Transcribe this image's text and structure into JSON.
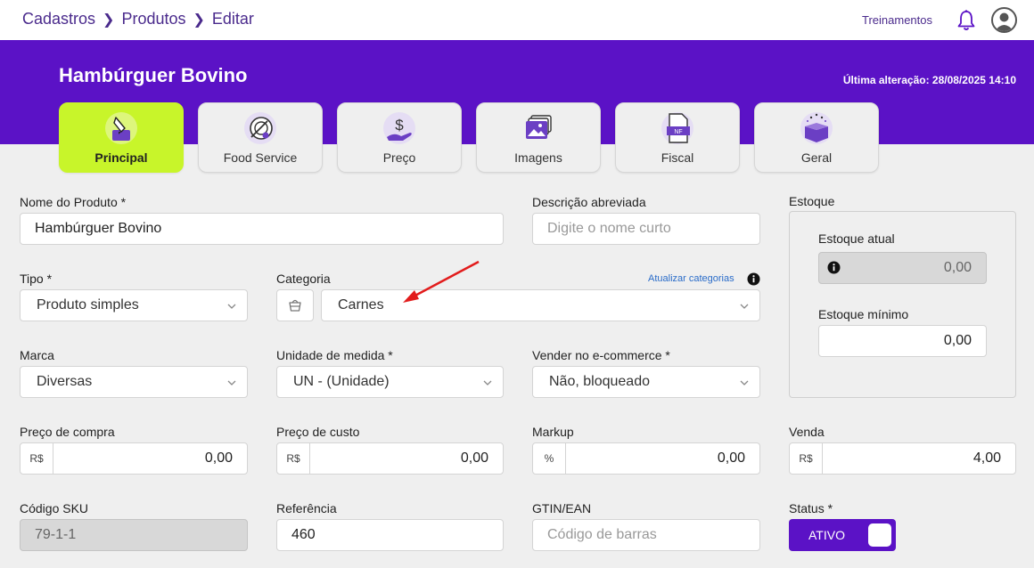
{
  "breadcrumb": [
    "Cadastros",
    "Produtos",
    "Editar"
  ],
  "header": {
    "training_link": "Treinamentos"
  },
  "product": {
    "title": "Hambúrguer Bovino",
    "last_change_label": "Última alteração:",
    "last_change_value": "28/08/2025 14:10"
  },
  "tabs": [
    {
      "label": "Principal",
      "icon": "pencil-tablet-icon",
      "active": true
    },
    {
      "label": "Food Service",
      "icon": "plate-cutlery-icon",
      "active": false
    },
    {
      "label": "Preço",
      "icon": "dollar-hand-icon",
      "active": false
    },
    {
      "label": "Imagens",
      "icon": "images-icon",
      "active": false
    },
    {
      "label": "Fiscal",
      "icon": "nf-document-icon",
      "active": false
    },
    {
      "label": "Geral",
      "icon": "gift-box-icon",
      "active": false
    }
  ],
  "form": {
    "nome": {
      "label": "Nome do Produto *",
      "value": "Hambúrguer Bovino"
    },
    "descricao": {
      "label": "Descrição abreviada",
      "placeholder": "Digite o nome curto"
    },
    "tipo": {
      "label": "Tipo *",
      "value": "Produto simples"
    },
    "categoria": {
      "label": "Categoria",
      "value": "Carnes",
      "update_link": "Atualizar categorias"
    },
    "marca": {
      "label": "Marca",
      "value": "Diversas"
    },
    "unidade": {
      "label": "Unidade de medida *",
      "value": "UN - (Unidade)"
    },
    "ecommerce": {
      "label": "Vender no e-commerce *",
      "value": "Não, bloqueado"
    },
    "preco_compra": {
      "label": "Preço de compra",
      "prefix": "R$",
      "value": "0,00"
    },
    "preco_custo": {
      "label": "Preço de custo",
      "prefix": "R$",
      "value": "0,00"
    },
    "markup": {
      "label": "Markup",
      "prefix": "%",
      "value": "0,00"
    },
    "venda": {
      "label": "Venda",
      "prefix": "R$",
      "value": "4,00"
    },
    "sku": {
      "label": "Código SKU",
      "value": "79-1-1"
    },
    "referencia": {
      "label": "Referência",
      "value": "460"
    },
    "gtin": {
      "label": "GTIN/EAN",
      "placeholder": "Código de barras"
    },
    "status": {
      "label": "Status *",
      "value": "ATIVO"
    }
  },
  "estoque": {
    "title": "Estoque",
    "atual": {
      "label": "Estoque atual",
      "value": "0,00"
    },
    "minimo": {
      "label": "Estoque mínimo",
      "value": "0,00"
    }
  },
  "colors": {
    "brand": "#5b12c6",
    "active_tab": "#c8f52a",
    "link": "#2a6cc9"
  }
}
